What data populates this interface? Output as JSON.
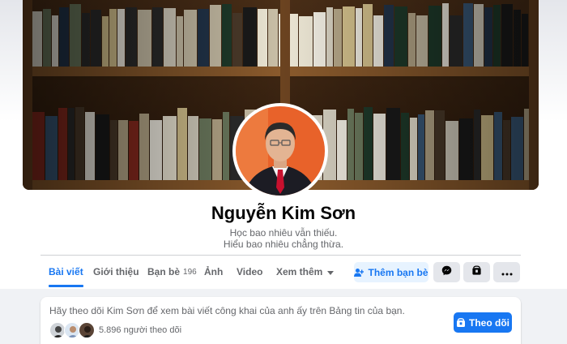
{
  "profile": {
    "name": "Nguyễn Kim Sơn",
    "bio_line1": "Học bao nhiêu vẫn thiếu.",
    "bio_line2": "Hiểu bao nhiêu chẳng thừa."
  },
  "tabs": [
    {
      "label": "Bài viết",
      "active": true
    },
    {
      "label": "Giới thiệu"
    },
    {
      "label": "Bạn bè",
      "count": "196"
    },
    {
      "label": "Ảnh"
    },
    {
      "label": "Video"
    },
    {
      "label": "Xem thêm"
    }
  ],
  "actions": {
    "add_friend_label": "Thêm bạn bè",
    "messenger_icon": "messenger-icon",
    "save_icon": "bookmark-icon",
    "more_icon": "more-dots-icon"
  },
  "follow_card": {
    "prompt": "Hãy theo dõi Kim Sơn để xem bài viết công khai của anh ấy trên Bảng tin của bạn.",
    "follower_count_text": "5.896 người theo dõi",
    "follow_label": "Theo dõi"
  },
  "colors": {
    "accent": "#1877f2",
    "accent_light": "#e7f3ff",
    "secondary_text": "#65676b",
    "page_bg": "#f0f2f5"
  }
}
